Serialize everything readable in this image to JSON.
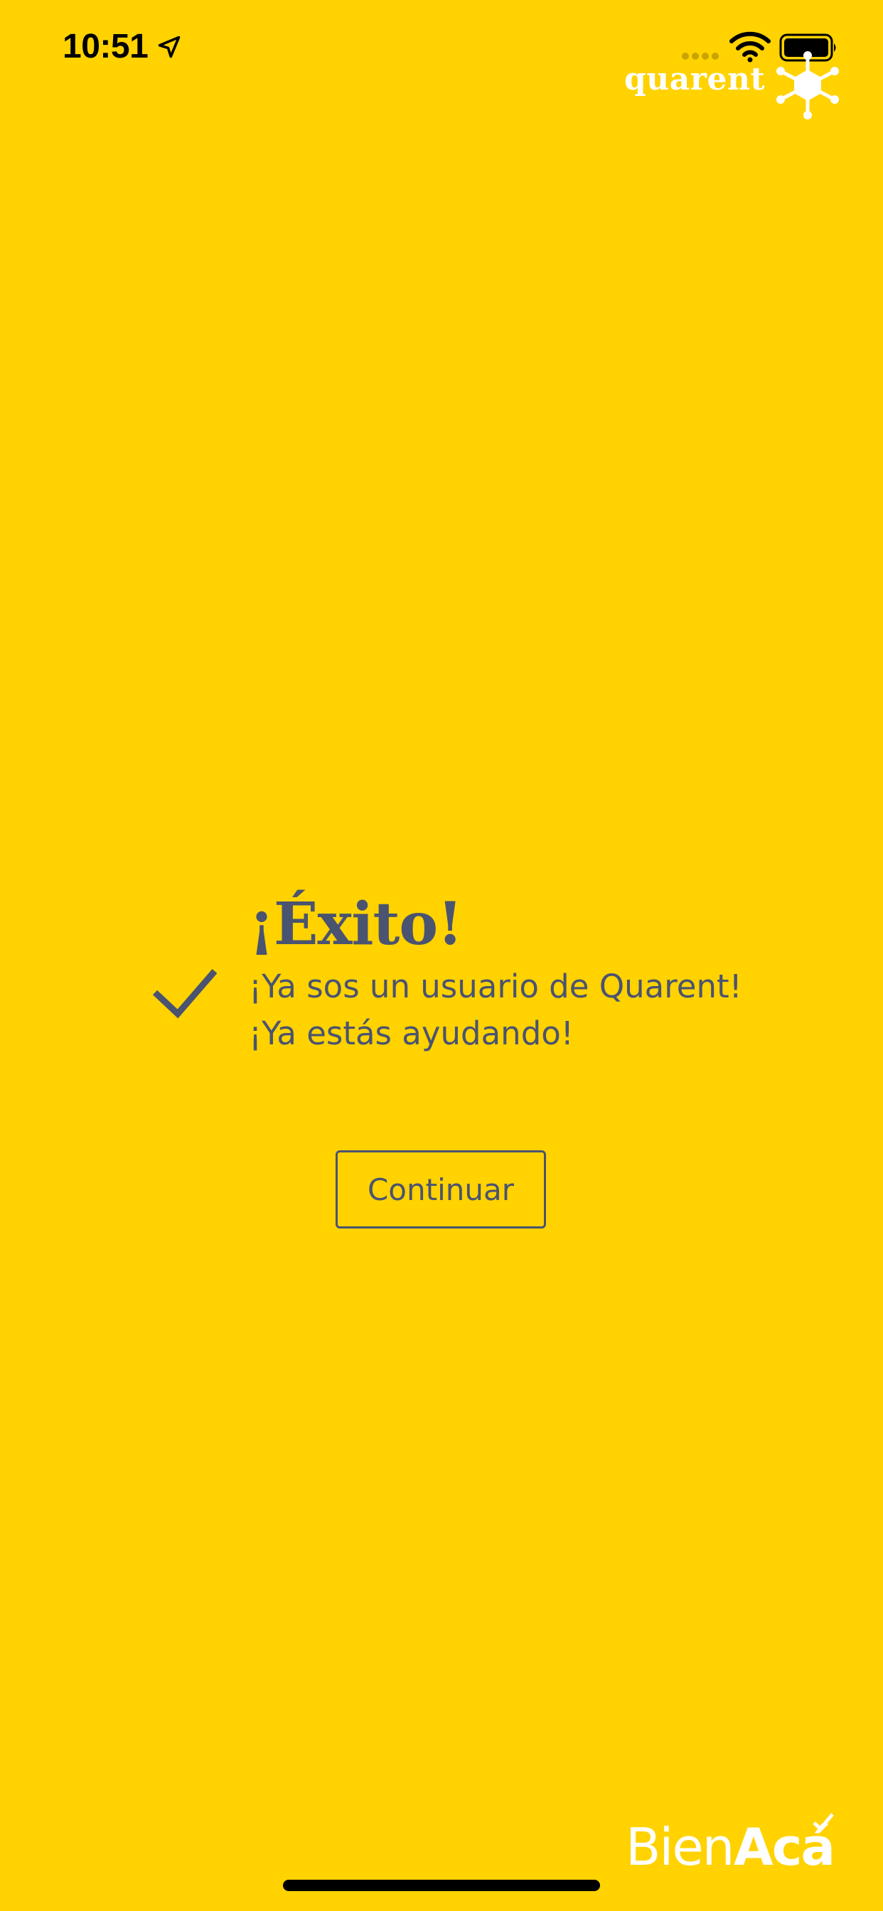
{
  "status_bar": {
    "time": "10:51",
    "icons": [
      "location-arrow-icon",
      "cellular-signal-icon",
      "wifi-icon",
      "battery-icon"
    ]
  },
  "brand": {
    "name": "quarent",
    "mark_icon": "network-hub-icon"
  },
  "success": {
    "icon": "checkmark-icon",
    "title": "¡Éxito!",
    "line1": "¡Ya sos un usuario de Quarent!",
    "line2": "¡Ya estás ayudando!"
  },
  "actions": {
    "continue_label": "Continuar"
  },
  "footer": {
    "logo_light": "Bien",
    "logo_bold": "Acá"
  },
  "colors": {
    "background": "#FFD200",
    "text": "#4A5370",
    "logo": "#FFFFFF"
  }
}
